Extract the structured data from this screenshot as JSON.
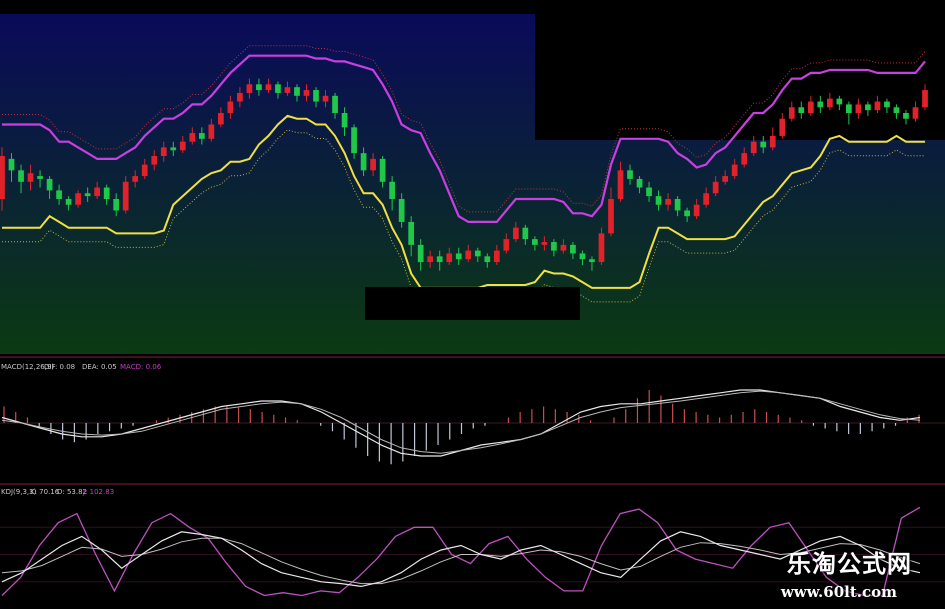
{
  "chart_data": [
    {
      "type": "candlestick",
      "panel": "main",
      "overlays": [
        "upper band (magenta/red)",
        "lower band (yellow dotted)"
      ],
      "candles": [
        {
          "o": 30,
          "c": 45,
          "h": 48,
          "l": 26
        },
        {
          "o": 44,
          "c": 40,
          "h": 46,
          "l": 36
        },
        {
          "o": 40,
          "c": 36,
          "h": 42,
          "l": 32
        },
        {
          "o": 36,
          "c": 39,
          "h": 42,
          "l": 33
        },
        {
          "o": 38,
          "c": 37,
          "h": 40,
          "l": 34
        },
        {
          "o": 37,
          "c": 33,
          "h": 38,
          "l": 30
        },
        {
          "o": 33,
          "c": 30,
          "h": 35,
          "l": 28
        },
        {
          "o": 30,
          "c": 28,
          "h": 31,
          "l": 26
        },
        {
          "o": 28,
          "c": 32,
          "h": 33,
          "l": 27
        },
        {
          "o": 32,
          "c": 31,
          "h": 34,
          "l": 29
        },
        {
          "o": 31,
          "c": 34,
          "h": 36,
          "l": 30
        },
        {
          "o": 34,
          "c": 30,
          "h": 35,
          "l": 28
        },
        {
          "o": 30,
          "c": 26,
          "h": 32,
          "l": 24
        },
        {
          "o": 26,
          "c": 36,
          "h": 38,
          "l": 25
        },
        {
          "o": 36,
          "c": 38,
          "h": 40,
          "l": 34
        },
        {
          "o": 38,
          "c": 42,
          "h": 44,
          "l": 37
        },
        {
          "o": 42,
          "c": 45,
          "h": 47,
          "l": 40
        },
        {
          "o": 45,
          "c": 48,
          "h": 50,
          "l": 43
        },
        {
          "o": 48,
          "c": 47,
          "h": 50,
          "l": 45
        },
        {
          "o": 47,
          "c": 50,
          "h": 52,
          "l": 46
        },
        {
          "o": 50,
          "c": 53,
          "h": 55,
          "l": 49
        },
        {
          "o": 53,
          "c": 51,
          "h": 55,
          "l": 49
        },
        {
          "o": 51,
          "c": 56,
          "h": 58,
          "l": 50
        },
        {
          "o": 56,
          "c": 60,
          "h": 62,
          "l": 55
        },
        {
          "o": 60,
          "c": 64,
          "h": 66,
          "l": 58
        },
        {
          "o": 64,
          "c": 67,
          "h": 69,
          "l": 62
        },
        {
          "o": 67,
          "c": 70,
          "h": 72,
          "l": 65
        },
        {
          "o": 70,
          "c": 68,
          "h": 72,
          "l": 66
        },
        {
          "o": 68,
          "c": 70,
          "h": 72,
          "l": 67
        },
        {
          "o": 70,
          "c": 67,
          "h": 71,
          "l": 65
        },
        {
          "o": 67,
          "c": 69,
          "h": 71,
          "l": 66
        },
        {
          "o": 69,
          "c": 66,
          "h": 70,
          "l": 64
        },
        {
          "o": 66,
          "c": 68,
          "h": 70,
          "l": 64
        },
        {
          "o": 68,
          "c": 64,
          "h": 69,
          "l": 62
        },
        {
          "o": 64,
          "c": 66,
          "h": 68,
          "l": 62
        },
        {
          "o": 66,
          "c": 60,
          "h": 67,
          "l": 58
        },
        {
          "o": 60,
          "c": 55,
          "h": 62,
          "l": 52
        },
        {
          "o": 55,
          "c": 46,
          "h": 56,
          "l": 44
        },
        {
          "o": 46,
          "c": 40,
          "h": 48,
          "l": 38
        },
        {
          "o": 40,
          "c": 44,
          "h": 46,
          "l": 38
        },
        {
          "o": 44,
          "c": 36,
          "h": 45,
          "l": 34
        },
        {
          "o": 36,
          "c": 30,
          "h": 38,
          "l": 26
        },
        {
          "o": 30,
          "c": 22,
          "h": 32,
          "l": 20
        },
        {
          "o": 22,
          "c": 14,
          "h": 24,
          "l": 10
        },
        {
          "o": 14,
          "c": 8,
          "h": 16,
          "l": 5
        },
        {
          "o": 8,
          "c": 10,
          "h": 12,
          "l": 6
        },
        {
          "o": 10,
          "c": 8,
          "h": 12,
          "l": 5
        },
        {
          "o": 8,
          "c": 11,
          "h": 13,
          "l": 7
        },
        {
          "o": 11,
          "c": 9,
          "h": 13,
          "l": 7
        },
        {
          "o": 9,
          "c": 12,
          "h": 14,
          "l": 8
        },
        {
          "o": 12,
          "c": 10,
          "h": 13,
          "l": 8
        },
        {
          "o": 10,
          "c": 8,
          "h": 11,
          "l": 6
        },
        {
          "o": 8,
          "c": 12,
          "h": 14,
          "l": 7
        },
        {
          "o": 12,
          "c": 16,
          "h": 18,
          "l": 11
        },
        {
          "o": 16,
          "c": 20,
          "h": 22,
          "l": 15
        },
        {
          "o": 20,
          "c": 16,
          "h": 21,
          "l": 14
        },
        {
          "o": 16,
          "c": 14,
          "h": 17,
          "l": 12
        },
        {
          "o": 14,
          "c": 15,
          "h": 17,
          "l": 12
        },
        {
          "o": 15,
          "c": 12,
          "h": 16,
          "l": 10
        },
        {
          "o": 12,
          "c": 14,
          "h": 16,
          "l": 11
        },
        {
          "o": 14,
          "c": 11,
          "h": 15,
          "l": 9
        },
        {
          "o": 11,
          "c": 9,
          "h": 12,
          "l": 7
        },
        {
          "o": 9,
          "c": 8,
          "h": 10,
          "l": 5
        },
        {
          "o": 8,
          "c": 18,
          "h": 20,
          "l": 7
        },
        {
          "o": 18,
          "c": 30,
          "h": 34,
          "l": 17
        },
        {
          "o": 30,
          "c": 40,
          "h": 43,
          "l": 29
        },
        {
          "o": 40,
          "c": 37,
          "h": 42,
          "l": 35
        },
        {
          "o": 37,
          "c": 34,
          "h": 38,
          "l": 32
        },
        {
          "o": 34,
          "c": 31,
          "h": 36,
          "l": 29
        },
        {
          "o": 31,
          "c": 28,
          "h": 33,
          "l": 26
        },
        {
          "o": 28,
          "c": 30,
          "h": 32,
          "l": 26
        },
        {
          "o": 30,
          "c": 26,
          "h": 31,
          "l": 24
        },
        {
          "o": 26,
          "c": 24,
          "h": 27,
          "l": 22
        },
        {
          "o": 24,
          "c": 28,
          "h": 30,
          "l": 23
        },
        {
          "o": 28,
          "c": 32,
          "h": 34,
          "l": 27
        },
        {
          "o": 32,
          "c": 36,
          "h": 38,
          "l": 31
        },
        {
          "o": 36,
          "c": 38,
          "h": 40,
          "l": 35
        },
        {
          "o": 38,
          "c": 42,
          "h": 44,
          "l": 37
        },
        {
          "o": 42,
          "c": 46,
          "h": 48,
          "l": 41
        },
        {
          "o": 46,
          "c": 50,
          "h": 52,
          "l": 45
        },
        {
          "o": 50,
          "c": 48,
          "h": 52,
          "l": 46
        },
        {
          "o": 48,
          "c": 52,
          "h": 55,
          "l": 47
        },
        {
          "o": 52,
          "c": 58,
          "h": 60,
          "l": 51
        },
        {
          "o": 58,
          "c": 62,
          "h": 64,
          "l": 57
        },
        {
          "o": 62,
          "c": 60,
          "h": 64,
          "l": 58
        },
        {
          "o": 60,
          "c": 64,
          "h": 66,
          "l": 59
        },
        {
          "o": 64,
          "c": 62,
          "h": 66,
          "l": 60
        },
        {
          "o": 62,
          "c": 65,
          "h": 67,
          "l": 61
        },
        {
          "o": 65,
          "c": 63,
          "h": 66,
          "l": 61
        },
        {
          "o": 63,
          "c": 60,
          "h": 64,
          "l": 56
        },
        {
          "o": 60,
          "c": 63,
          "h": 65,
          "l": 58
        },
        {
          "o": 63,
          "c": 61,
          "h": 64,
          "l": 59
        },
        {
          "o": 61,
          "c": 64,
          "h": 66,
          "l": 60
        },
        {
          "o": 64,
          "c": 62,
          "h": 65,
          "l": 60
        },
        {
          "o": 62,
          "c": 60,
          "h": 63,
          "l": 58
        },
        {
          "o": 60,
          "c": 58,
          "h": 61,
          "l": 56
        },
        {
          "o": 58,
          "c": 62,
          "h": 64,
          "l": 57
        },
        {
          "o": 62,
          "c": 68,
          "h": 70,
          "l": 61
        }
      ]
    },
    {
      "type": "bar+line",
      "panel": "MACD",
      "title": "MACD(12,26,9) DIF: 0.08 DEA: 0.05 MACD: 0.06",
      "title_parts": {
        "prefix": "MACD(12,26,9)",
        "dif": "DIF: 0.08",
        "dea": "DEA: 0.05",
        "macd": "MACD: 0.06"
      },
      "hist": [
        0.3,
        0.2,
        0.1,
        -0.1,
        -0.2,
        -0.3,
        -0.35,
        -0.3,
        -0.2,
        -0.15,
        -0.1,
        -0.05,
        0,
        0.05,
        0.1,
        0.15,
        0.2,
        0.25,
        0.3,
        0.3,
        0.28,
        0.25,
        0.2,
        0.15,
        0.1,
        0.05,
        0,
        -0.05,
        -0.15,
        -0.3,
        -0.45,
        -0.6,
        -0.7,
        -0.75,
        -0.7,
        -0.6,
        -0.5,
        -0.4,
        -0.3,
        -0.2,
        -0.1,
        -0.05,
        0,
        0.1,
        0.2,
        0.25,
        0.3,
        0.25,
        0.2,
        0.15,
        0.05,
        0,
        0.1,
        0.25,
        0.45,
        0.6,
        0.5,
        0.35,
        0.25,
        0.2,
        0.15,
        0.1,
        0.15,
        0.2,
        0.25,
        0.2,
        0.15,
        0.1,
        0.05,
        -0.05,
        -0.1,
        -0.15,
        -0.2,
        -0.2,
        -0.15,
        -0.1,
        -0.05,
        0.1,
        0.15
      ],
      "dif": [
        0.1,
        0.0,
        -0.1,
        -0.2,
        -0.25,
        -0.25,
        -0.2,
        -0.1,
        0,
        0.1,
        0.2,
        0.3,
        0.35,
        0.4,
        0.4,
        0.35,
        0.2,
        0,
        -0.2,
        -0.4,
        -0.55,
        -0.6,
        -0.6,
        -0.5,
        -0.4,
        -0.35,
        -0.3,
        -0.2,
        0,
        0.2,
        0.3,
        0.35,
        0.35,
        0.4,
        0.45,
        0.5,
        0.55,
        0.6,
        0.6,
        0.55,
        0.5,
        0.45,
        0.3,
        0.2,
        0.1,
        0.05,
        0.1
      ],
      "dea": [
        0.05,
        0.0,
        -0.08,
        -0.15,
        -0.2,
        -0.22,
        -0.2,
        -0.15,
        -0.05,
        0.05,
        0.15,
        0.25,
        0.3,
        0.35,
        0.38,
        0.35,
        0.25,
        0.1,
        -0.1,
        -0.3,
        -0.45,
        -0.52,
        -0.55,
        -0.5,
        -0.45,
        -0.38,
        -0.3,
        -0.2,
        -0.05,
        0.1,
        0.2,
        0.28,
        0.32,
        0.36,
        0.4,
        0.45,
        0.5,
        0.55,
        0.58,
        0.55,
        0.5,
        0.45,
        0.35,
        0.25,
        0.15,
        0.08,
        0.05
      ]
    },
    {
      "type": "line",
      "panel": "KDJ",
      "title": "KDJ(9,3,3) K: 70.16 D: 53.82 J: 102.83",
      "title_parts": {
        "prefix": "KDJ(9,3,3)",
        "k": "K: 70.16",
        "d": "D: 53.82",
        "j": "J: 102.83"
      },
      "k": [
        20,
        30,
        45,
        60,
        70,
        55,
        35,
        50,
        65,
        75,
        72,
        68,
        55,
        40,
        30,
        25,
        20,
        18,
        15,
        20,
        30,
        45,
        55,
        60,
        50,
        45,
        55,
        60,
        50,
        40,
        30,
        25,
        45,
        65,
        75,
        70,
        60,
        55,
        50,
        45,
        55,
        65,
        70,
        60,
        45,
        35,
        30
      ],
      "d": [
        30,
        32,
        38,
        48,
        58,
        56,
        48,
        50,
        56,
        64,
        68,
        68,
        62,
        52,
        42,
        34,
        27,
        22,
        18,
        18,
        23,
        32,
        42,
        50,
        50,
        48,
        51,
        55,
        53,
        48,
        40,
        33,
        37,
        48,
        58,
        63,
        62,
        59,
        55,
        50,
        52,
        57,
        62,
        61,
        55,
        47,
        40
      ],
      "j": [
        5,
        25,
        60,
        85,
        95,
        50,
        10,
        50,
        85,
        95,
        80,
        68,
        40,
        15,
        5,
        8,
        5,
        10,
        8,
        25,
        45,
        70,
        80,
        80,
        50,
        40,
        62,
        70,
        45,
        25,
        10,
        10,
        60,
        95,
        100,
        85,
        55,
        45,
        40,
        35,
        60,
        80,
        85,
        55,
        25,
        10,
        5,
        5,
        90,
        102
      ]
    }
  ],
  "colors": {
    "bg_top": "#0a0a5a",
    "bg_bottom": "#0b3a12",
    "candle_up": "#e2222a",
    "candle_down": "#20c84a",
    "upper_band": "#c840e0",
    "upper_band_dots": "#c03040",
    "lower_band": "#f0e040",
    "lower_band_dots": "#c8b040",
    "macd_hist_pos": "#c85050",
    "macd_hist_neg": "#c0c8d8",
    "line_white": "#e8e8e8",
    "line_pink": "#c050c0",
    "separator": "#802040",
    "title_text": "#c8c8c8",
    "title_accent": "#c040c0"
  },
  "watermark": {
    "line1": "乐淘公式网",
    "line2": "www.60lt.com"
  }
}
